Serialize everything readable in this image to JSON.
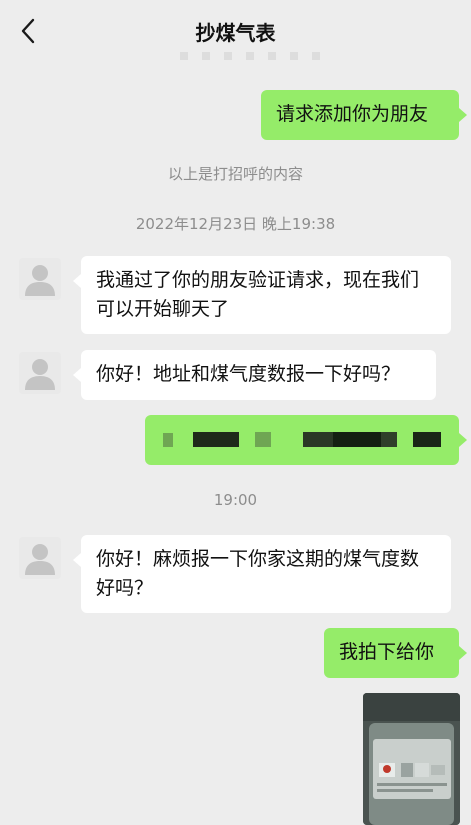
{
  "header": {
    "back_icon": "chevron-left-icon",
    "title": "抄煤气表"
  },
  "messages": {
    "m1": {
      "text": "请求添加你为朋友"
    },
    "sys1": {
      "text": "以上是打招呼的内容"
    },
    "ts1": {
      "text": "2022年12月23日 晚上19:38"
    },
    "m2": {
      "text": "我通过了你的朋友验证请求，现在我们可以开始聊天了"
    },
    "m3": {
      "text": "你好！地址和煤气度数报一下好吗？"
    },
    "m4": {
      "text": ""
    },
    "ts2": {
      "text": "19:00"
    },
    "m5": {
      "text": "你好！麻烦报一下你家这期的煤气度数好吗？"
    },
    "m6": {
      "text": "我拍下给你"
    }
  },
  "colors": {
    "background": "#ededed",
    "outgoing_bubble": "#95ec69",
    "incoming_bubble": "#ffffff",
    "system_text": "#8d8d8d"
  }
}
